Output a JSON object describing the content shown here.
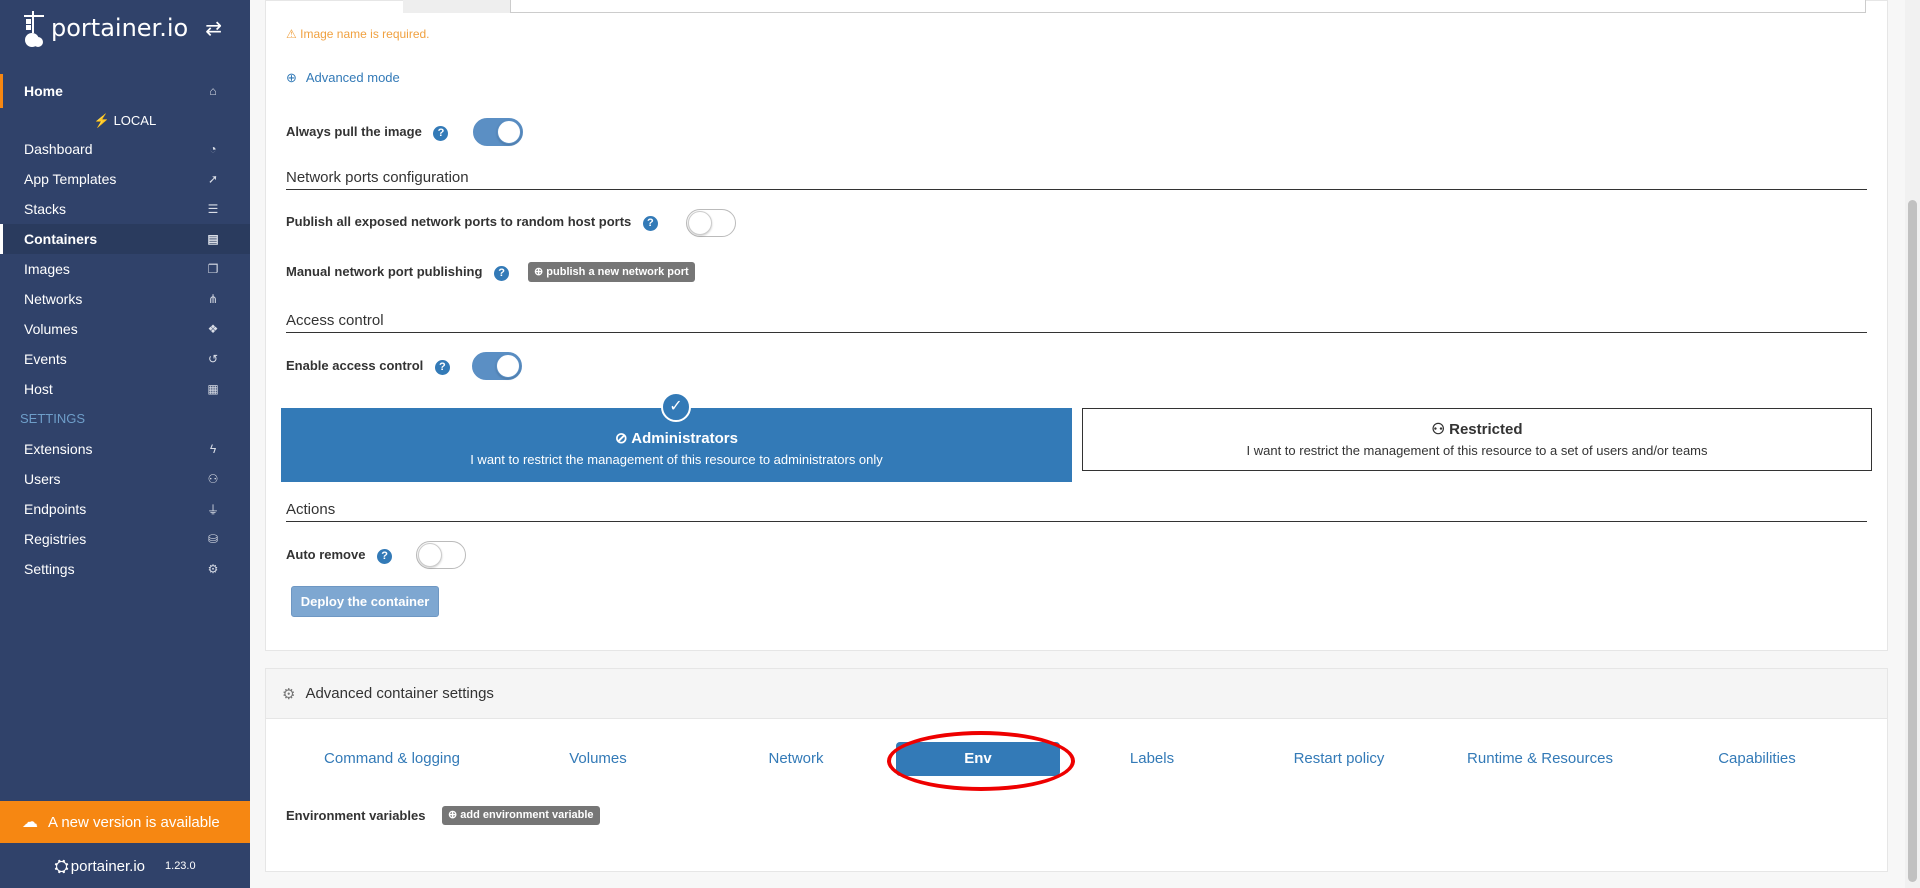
{
  "sidebar": {
    "brand": "portainer.io",
    "home": "Home",
    "endpoint": "LOCAL",
    "items": [
      {
        "label": "Dashboard",
        "icon": "tachometer-icon"
      },
      {
        "label": "App Templates",
        "icon": "rocket-icon"
      },
      {
        "label": "Stacks",
        "icon": "th-list-icon"
      },
      {
        "label": "Containers",
        "icon": "server-icon"
      },
      {
        "label": "Images",
        "icon": "clone-icon"
      },
      {
        "label": "Networks",
        "icon": "sitemap-icon"
      },
      {
        "label": "Volumes",
        "icon": "cubes-icon"
      },
      {
        "label": "Events",
        "icon": "history-icon"
      },
      {
        "label": "Host",
        "icon": "th-icon"
      }
    ],
    "settings_header": "SETTINGS",
    "settings_items": [
      {
        "label": "Extensions",
        "icon": "bolt-icon"
      },
      {
        "label": "Users",
        "icon": "users-icon"
      },
      {
        "label": "Endpoints",
        "icon": "plug-icon"
      },
      {
        "label": "Registries",
        "icon": "database-icon"
      },
      {
        "label": "Settings",
        "icon": "cogs-icon"
      }
    ],
    "update_notice": "A new version is available",
    "footer_brand": "portainer.io",
    "version": "1.23.0"
  },
  "form": {
    "image_warning": "Image name is required.",
    "advanced_mode": "Advanced mode",
    "always_pull_label": "Always pull the image",
    "network_ports_title": "Network ports configuration",
    "publish_all_label": "Publish all exposed network ports to random host ports",
    "manual_publish_label": "Manual network port publishing",
    "publish_new_port": "publish a new network port",
    "access_control_title": "Access control",
    "enable_access_label": "Enable access control",
    "admins_title": "Administrators",
    "admins_desc": "I want to restrict the management of this resource to administrators only",
    "restricted_title": "Restricted",
    "restricted_desc": "I want to restrict the management of this resource to a set of users and/or teams",
    "actions_title": "Actions",
    "auto_remove_label": "Auto remove",
    "deploy_button": "Deploy the container"
  },
  "toggles": {
    "always_pull": true,
    "publish_all": false,
    "access_control": true,
    "auto_remove": false
  },
  "advanced": {
    "title": "Advanced container settings",
    "tabs": [
      "Command & logging",
      "Volumes",
      "Network",
      "Env",
      "Labels",
      "Restart policy",
      "Runtime & Resources",
      "Capabilities"
    ],
    "active_tab": "Env",
    "env_label": "Environment variables",
    "add_env": "add environment variable"
  },
  "colors": {
    "sidebar_bg": "#30426a",
    "accent": "#337ab7",
    "orange": "#f68712",
    "highlight_ring": "#e00000"
  }
}
